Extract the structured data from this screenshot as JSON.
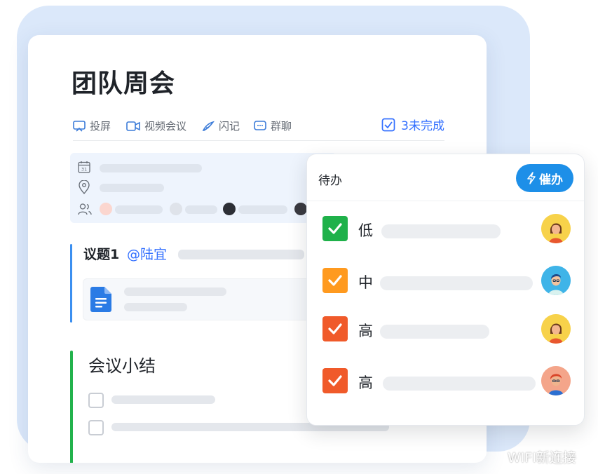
{
  "meeting": {
    "title": "团队周会",
    "toolbar": {
      "screen_share": "投屏",
      "video_call": "视频会议",
      "notes": "闪记",
      "group_chat": "群聊",
      "pending": "3未完成"
    },
    "info": {
      "calendar_day": "31"
    },
    "topic": {
      "label": "议题1",
      "mention": "@陆宜"
    },
    "summary": {
      "title": "会议小结"
    }
  },
  "todo_popup": {
    "title": "待办",
    "urge_button": "催办",
    "tasks": [
      {
        "priority": "低",
        "checked": true,
        "check_color": "#1fb14a"
      },
      {
        "priority": "中",
        "checked": true,
        "check_color": "#ff9a1f"
      },
      {
        "priority": "高",
        "checked": true,
        "check_color": "#f05a2a"
      },
      {
        "priority": "高",
        "checked": true,
        "check_color": "#f05a2a"
      }
    ]
  },
  "colors": {
    "accent": "#3370ff",
    "urge_button": "#1d8fe8",
    "topic_bar": "#3b8ff0",
    "summary_bar": "#22b24c",
    "background_blob": "#dbe8fa"
  },
  "watermark": "WIFI新连接"
}
